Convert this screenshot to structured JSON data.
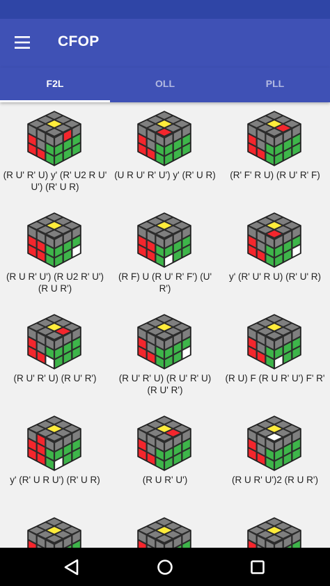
{
  "app_bar": {
    "title": "CFOP",
    "menu_icon": "hamburger-menu-icon"
  },
  "tabs": [
    {
      "label": "F2L",
      "active": true
    },
    {
      "label": "OLL",
      "active": false
    },
    {
      "label": "PLL",
      "active": false
    }
  ],
  "colors": {
    "primary": "#3f51b5",
    "status_bar": "#2f45a6",
    "sticker_gray": "#7f7f7f",
    "yellow": "#ffec3b",
    "red": "#f4262d",
    "green": "#3eb54a",
    "white": "#ffffff"
  },
  "cases": [
    {
      "alg": "(R U' R' U) y' (R' U2 R U' U') (R' U R)",
      "top": [
        "g",
        "g",
        "g",
        "g",
        "y",
        "g",
        "g",
        "g",
        "g"
      ],
      "left": [
        "g",
        "g",
        "g",
        "r",
        "g",
        "g",
        "r",
        "r",
        "g"
      ],
      "right": [
        "g",
        "r",
        "g",
        "g",
        "g",
        "g",
        "g",
        "g",
        "g"
      ]
    },
    {
      "alg": "(U R U' R' U') y' (R' U R)",
      "top": [
        "g",
        "g",
        "g",
        "g",
        "y",
        "g",
        "g",
        "g",
        "r"
      ],
      "left": [
        "g",
        "g",
        "g",
        "r",
        "g",
        "g",
        "r",
        "r",
        "g"
      ],
      "right": [
        "g",
        "g",
        "g",
        "g",
        "g",
        "g",
        "g",
        "g",
        "g"
      ]
    },
    {
      "alg": "(R' F' R U) (R U' R' F)",
      "top": [
        "g",
        "g",
        "g",
        "g",
        "y",
        "r",
        "g",
        "g",
        "g"
      ],
      "left": [
        "g",
        "g",
        "g",
        "r",
        "g",
        "g",
        "r",
        "r",
        "g"
      ],
      "right": [
        "g",
        "g",
        "g",
        "g",
        "g",
        "g",
        "g",
        "g",
        "g"
      ]
    },
    {
      "alg": "(R U R' U') (R U2 R' U') (R U R')",
      "top": [
        "g",
        "g",
        "g",
        "g",
        "y",
        "g",
        "g",
        "g",
        "g"
      ],
      "left": [
        "g",
        "g",
        "g",
        "r",
        "r",
        "g",
        "r",
        "r",
        "g"
      ],
      "right": [
        "g",
        "g",
        "g",
        "g",
        "g",
        "g",
        "g",
        "g",
        "w"
      ]
    },
    {
      "alg": "(R F) U (R U' R' F') (U' R')",
      "top": [
        "g",
        "g",
        "g",
        "g",
        "y",
        "g",
        "g",
        "g",
        "g"
      ],
      "left": [
        "g",
        "g",
        "g",
        "r",
        "r",
        "g",
        "r",
        "r",
        "g"
      ],
      "right": [
        "g",
        "g",
        "g",
        "g",
        "g",
        "g",
        "w",
        "g",
        "g"
      ]
    },
    {
      "alg": "y' (R' U' R U) (R' U' R)",
      "top": [
        "g",
        "g",
        "g",
        "g",
        "y",
        "g",
        "g",
        "g",
        "r"
      ],
      "left": [
        "g",
        "g",
        "g",
        "r",
        "g",
        "g",
        "r",
        "r",
        "g"
      ],
      "right": [
        "g",
        "g",
        "g",
        "g",
        "g",
        "g",
        "g",
        "g",
        "w"
      ]
    },
    {
      "alg": "(R U' R' U) (R U' R')",
      "top": [
        "g",
        "g",
        "g",
        "g",
        "y",
        "r",
        "g",
        "g",
        "g"
      ],
      "left": [
        "g",
        "g",
        "g",
        "r",
        "g",
        "g",
        "r",
        "r",
        "w"
      ],
      "right": [
        "g",
        "g",
        "g",
        "g",
        "g",
        "g",
        "g",
        "g",
        "g"
      ]
    },
    {
      "alg": "(R U' R' U) (R U' R' U) (R U' R')",
      "top": [
        "g",
        "g",
        "g",
        "g",
        "y",
        "g",
        "g",
        "g",
        "g"
      ],
      "left": [
        "g",
        "g",
        "g",
        "r",
        "g",
        "g",
        "r",
        "r",
        "g"
      ],
      "right": [
        "g",
        "g",
        "g",
        "g",
        "g",
        "g",
        "g",
        "g",
        "w"
      ]
    },
    {
      "alg": "(R U) F (R U R' U') F' R'",
      "top": [
        "g",
        "g",
        "g",
        "g",
        "y",
        "g",
        "g",
        "g",
        "g"
      ],
      "left": [
        "g",
        "g",
        "g",
        "r",
        "g",
        "g",
        "r",
        "r",
        "g"
      ],
      "right": [
        "g",
        "g",
        "g",
        "g",
        "g",
        "g",
        "w",
        "g",
        "g"
      ]
    },
    {
      "alg": "y' (R' U R U') (R' U R)",
      "top": [
        "g",
        "g",
        "g",
        "g",
        "y",
        "g",
        "g",
        "g",
        "g"
      ],
      "left": [
        "g",
        "r",
        "g",
        "r",
        "r",
        "g",
        "r",
        "r",
        "g"
      ],
      "right": [
        "g",
        "g",
        "g",
        "g",
        "g",
        "g",
        "w",
        "g",
        "g"
      ]
    },
    {
      "alg": "(R U R' U')",
      "top": [
        "g",
        "g",
        "g",
        "g",
        "y",
        "r",
        "g",
        "g",
        "g"
      ],
      "left": [
        "g",
        "g",
        "g",
        "r",
        "g",
        "g",
        "r",
        "r",
        "g"
      ],
      "right": [
        "g",
        "g",
        "g",
        "g",
        "g",
        "g",
        "g",
        "g",
        "g"
      ]
    },
    {
      "alg": "(R U R' U')2 (R U R')",
      "top": [
        "g",
        "g",
        "g",
        "g",
        "y",
        "g",
        "g",
        "g",
        "w"
      ],
      "left": [
        "g",
        "g",
        "g",
        "r",
        "g",
        "g",
        "r",
        "r",
        "g"
      ],
      "right": [
        "g",
        "g",
        "g",
        "g",
        "g",
        "g",
        "g",
        "g",
        "g"
      ]
    },
    {
      "alg": "",
      "top": [
        "g",
        "g",
        "g",
        "g",
        "y",
        "g",
        "g",
        "g",
        "g"
      ],
      "left": [
        "g",
        "g",
        "g",
        "r",
        "g",
        "g",
        "r",
        "r",
        "g"
      ],
      "right": [
        "g",
        "g",
        "g",
        "g",
        "g",
        "g",
        "g",
        "g",
        "g"
      ]
    },
    {
      "alg": "",
      "top": [
        "g",
        "g",
        "g",
        "g",
        "y",
        "g",
        "g",
        "g",
        "g"
      ],
      "left": [
        "g",
        "g",
        "g",
        "r",
        "g",
        "g",
        "r",
        "r",
        "g"
      ],
      "right": [
        "g",
        "g",
        "g",
        "g",
        "g",
        "g",
        "g",
        "g",
        "g"
      ]
    },
    {
      "alg": "",
      "top": [
        "g",
        "g",
        "g",
        "g",
        "y",
        "g",
        "g",
        "g",
        "g"
      ],
      "left": [
        "g",
        "g",
        "g",
        "r",
        "g",
        "g",
        "r",
        "r",
        "g"
      ],
      "right": [
        "g",
        "g",
        "g",
        "g",
        "g",
        "g",
        "g",
        "g",
        "g"
      ]
    }
  ],
  "nav": {
    "back_icon": "back-triangle-icon",
    "home_icon": "home-circle-icon",
    "recents_icon": "recents-square-icon"
  }
}
